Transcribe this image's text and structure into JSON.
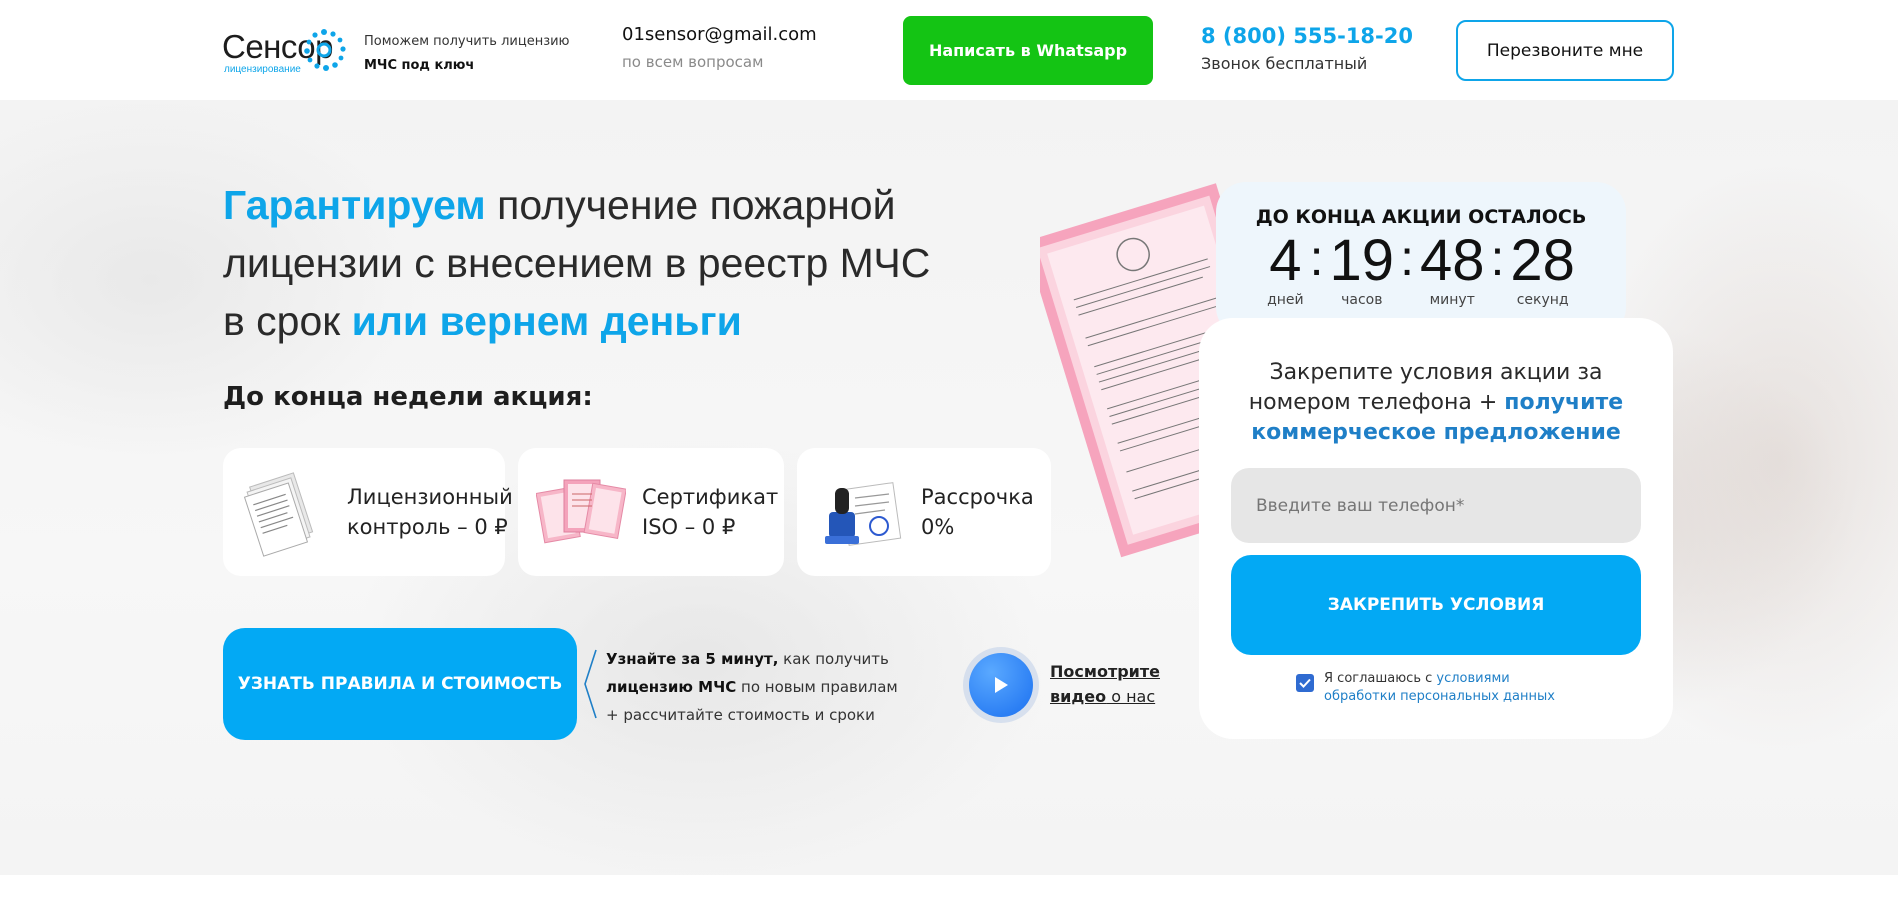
{
  "header": {
    "logo_text": "Сенсор",
    "logo_subtext": "лицензирование",
    "tagline_line1": "Поможем получить лицензию",
    "tagline_line2": "МЧС под ключ",
    "email": "01sensor@gmail.com",
    "email_note": "по всем вопросам",
    "whatsapp_button": "Написать в Whatsapp",
    "phone": "8 (800) 555-18-20",
    "phone_note": "Звонок бесплатный",
    "callback_button": "Перезвоните мне"
  },
  "hero": {
    "headline_accent1": "Гарантируем",
    "headline_middle1": " получение пожарной",
    "headline_middle2": "лицензии с внесением в реестр МЧС",
    "headline_middle3": "в срок ",
    "headline_accent2": "или вернем деньги",
    "subhead": "До конца недели акция:",
    "cards": [
      {
        "line1": "Лицензионный",
        "line2": "контроль – 0 ₽",
        "icon": "document-stack-icon"
      },
      {
        "line1": "Сертификат",
        "line2": "ISO – 0 ₽",
        "icon": "certificates-icon"
      },
      {
        "line1": "Рассрочка",
        "line2": "0%",
        "icon": "stamp-icon"
      }
    ],
    "rules_button": "УЗНАТЬ ПРАВИЛА И СТОИМОСТЬ",
    "rules_note_bold1": "Узнайте за 5 минут,",
    "rules_note_text1": " как получить",
    "rules_note_bold2": "лицензию МЧС",
    "rules_note_text2": " по новым правилам",
    "rules_note_line3": "+ рассчитайте стоимость и сроки",
    "video_link_line1": "Посмотрите",
    "video_link_word": "видео",
    "video_link_tail": " о нас"
  },
  "timer": {
    "title": "ДО КОНЦА АКЦИИ ОСТАЛОСЬ",
    "days": "4",
    "hours": "19",
    "minutes": "48",
    "seconds": "28",
    "sep": ":",
    "days_label": "дней",
    "hours_label": "часов",
    "minutes_label": "минут",
    "seconds_label": "секунд"
  },
  "form": {
    "text_plain": "Закрепите условия акции за номером телефона + ",
    "text_link": "получите коммерческое предложение",
    "phone_placeholder": "Введите ваш телефон*",
    "submit_button": "ЗАКРЕПИТЬ УСЛОВИЯ",
    "consent_plain": "Я соглашаюсь с ",
    "consent_link": "условиями обработки персональных данных",
    "consent_checked": true
  },
  "colors": {
    "accent": "#0ea5e9",
    "button_blue": "#03a9f4",
    "whatsapp_green": "#14c414",
    "link_blue": "#1f7fc7"
  }
}
